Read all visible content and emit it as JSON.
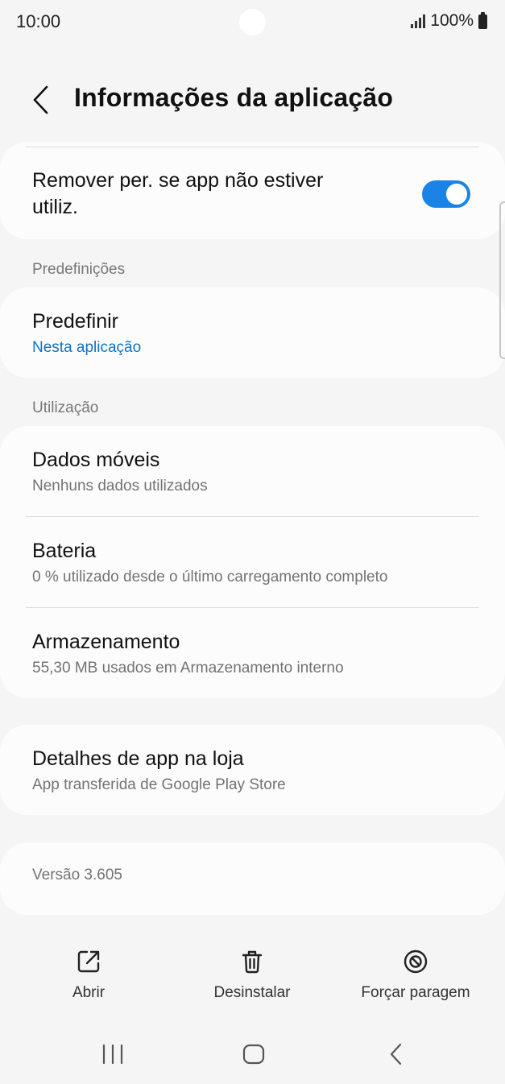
{
  "status": {
    "time": "10:00",
    "battery": "100%"
  },
  "header": {
    "title": "Informações da aplicação",
    "back_icon": "chevron-left-icon"
  },
  "remove_permissions": {
    "label_line1": "Remover per. se app não estiver",
    "label_line2": "utiliz.",
    "toggle_on": true
  },
  "defaults_section": {
    "label": "Predefinições",
    "title": "Predefinir",
    "subtitle": "Nesta aplicação"
  },
  "usage_section": {
    "label": "Utilização",
    "items": [
      {
        "title": "Dados móveis",
        "subtitle": "Nenhuns dados utilizados"
      },
      {
        "title": "Bateria",
        "subtitle": "0 % utilizado desde o último carregamento completo"
      },
      {
        "title": "Armazenamento",
        "subtitle": "55,30 MB usados em Armazenamento interno"
      }
    ]
  },
  "store": {
    "title": "Detalhes de app na loja",
    "subtitle": "App transferida de Google Play Store"
  },
  "version": {
    "text": "Versão 3.605"
  },
  "actions": [
    {
      "label": "Abrir",
      "icon": "open-external-icon"
    },
    {
      "label": "Desinstalar",
      "icon": "trash-icon"
    },
    {
      "label": "Forçar paragem",
      "icon": "force-stop-icon"
    }
  ],
  "navbar": {
    "recents_icon": "recents-icon",
    "home_icon": "home-icon",
    "back_icon": "back-icon"
  },
  "colors": {
    "accent": "#1a84e6",
    "link": "#1273c4",
    "background": "#f5f5f5",
    "card": "#fcfcfc"
  }
}
